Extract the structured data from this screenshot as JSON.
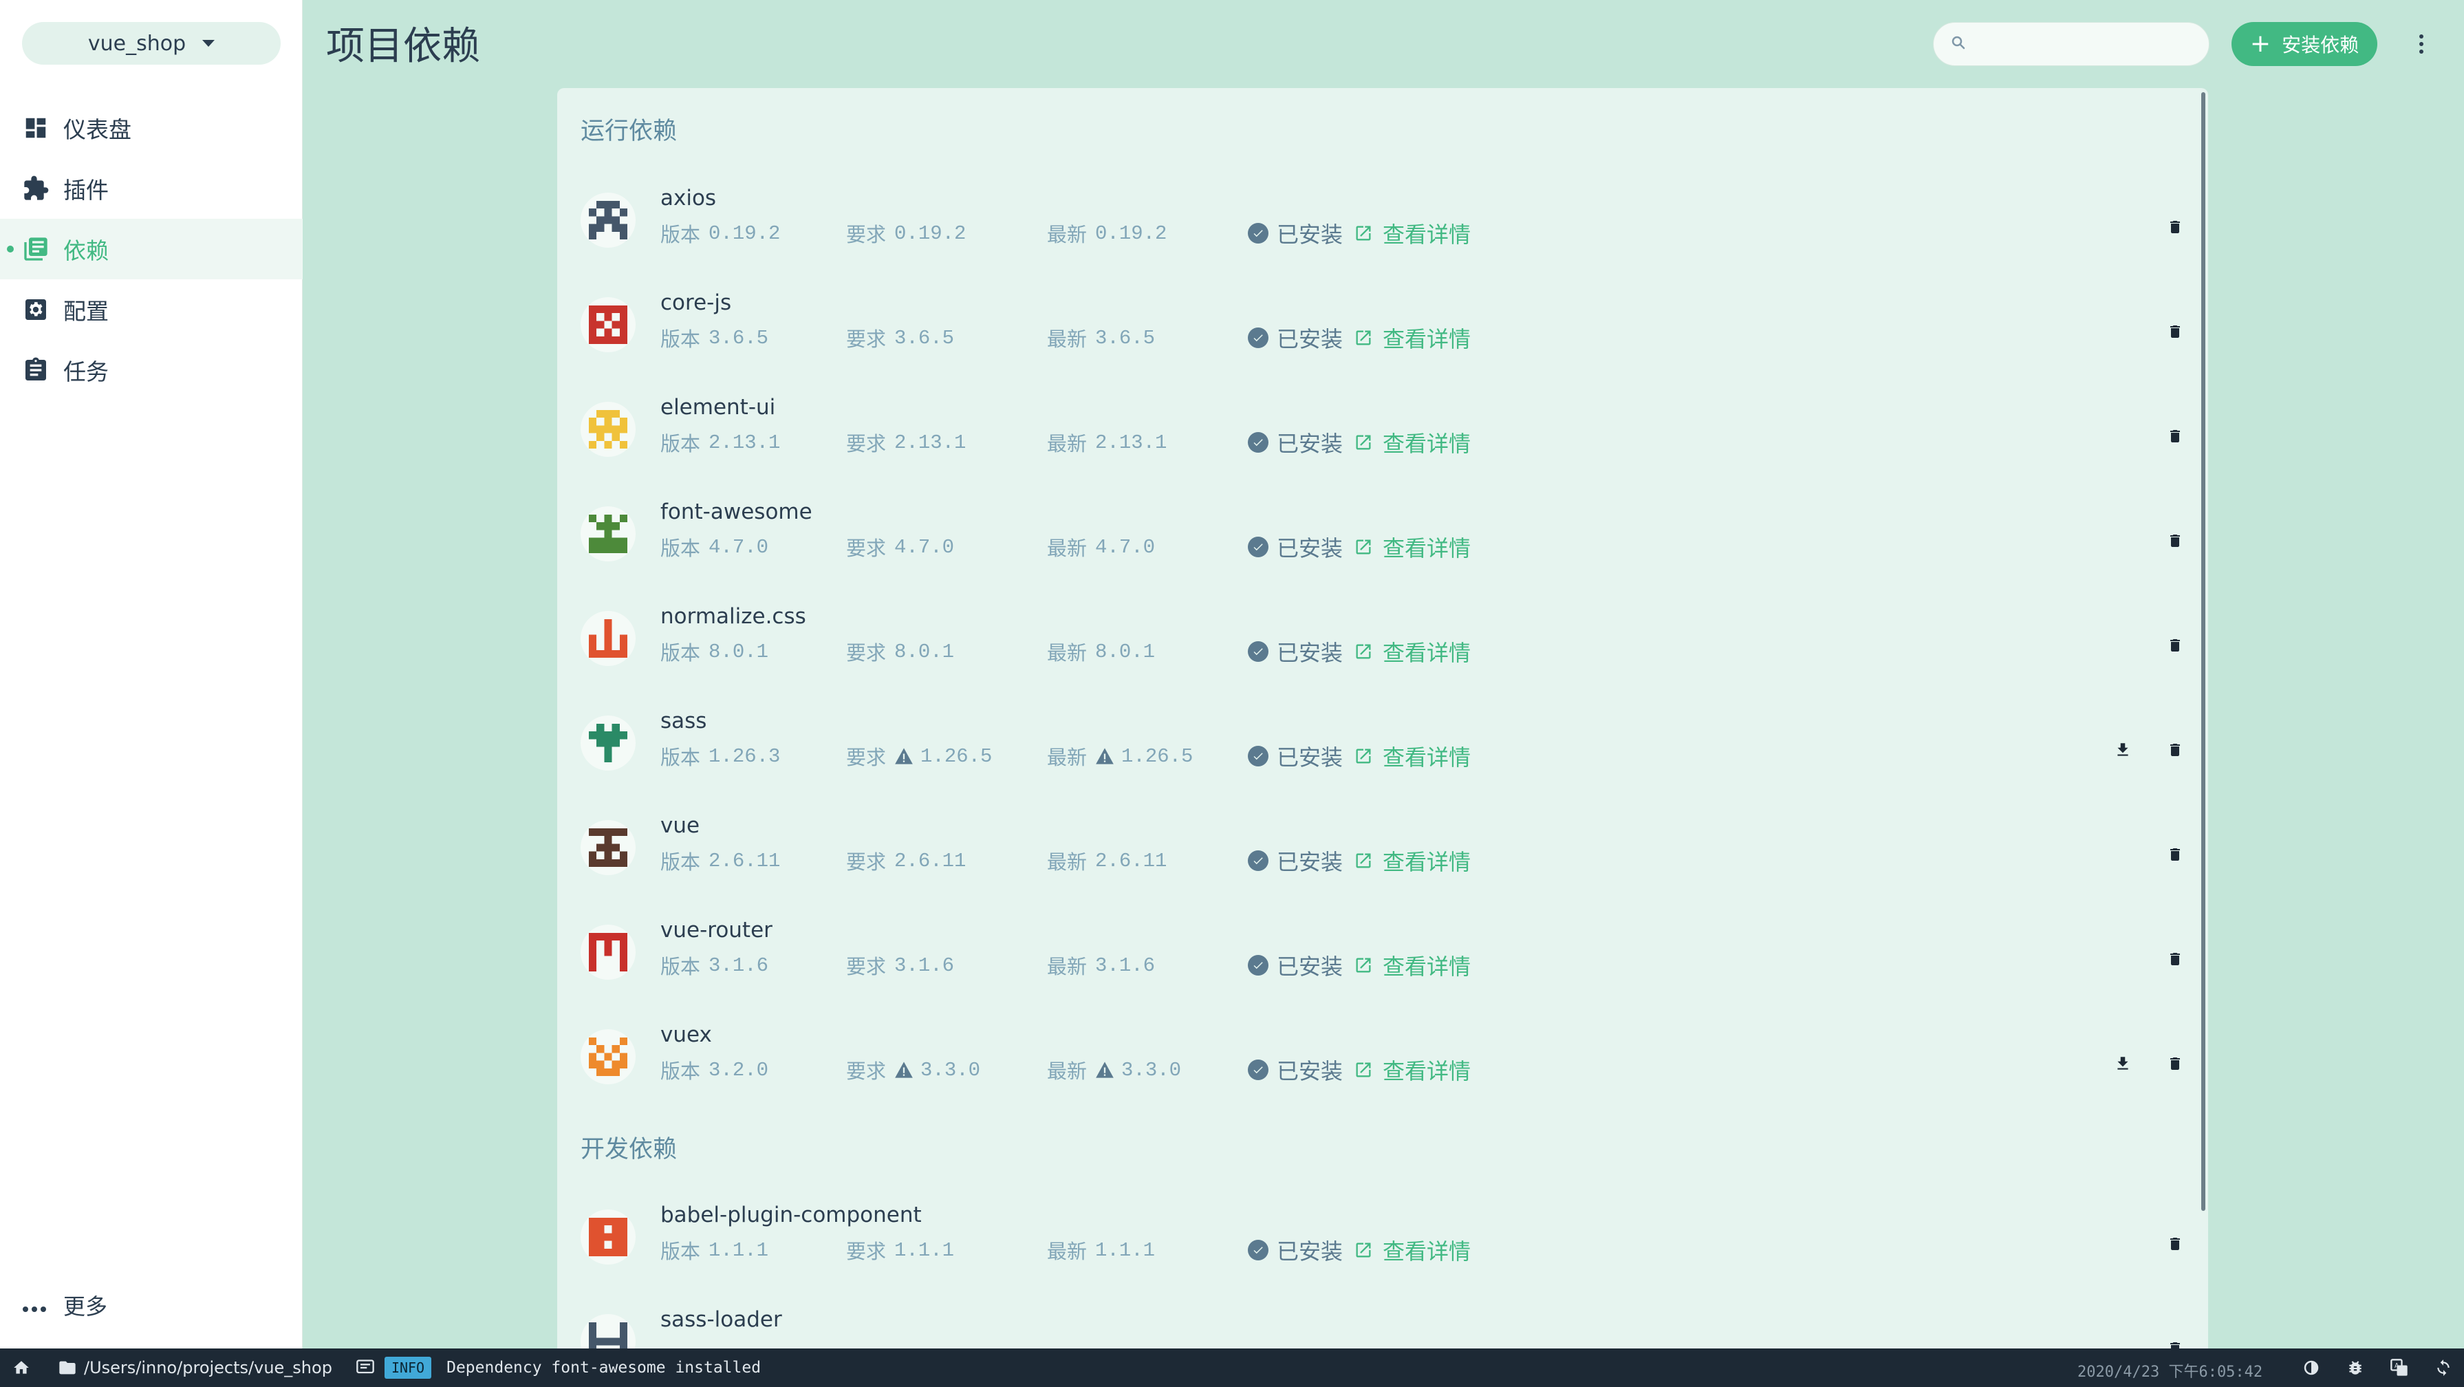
{
  "sidebar": {
    "project": "vue_shop",
    "items": [
      {
        "label": "仪表盘",
        "icon": "dashboard-icon"
      },
      {
        "label": "插件",
        "icon": "puzzle-icon"
      },
      {
        "label": "依赖",
        "icon": "library-icon",
        "active": true
      },
      {
        "label": "配置",
        "icon": "settings-icon"
      },
      {
        "label": "任务",
        "icon": "clipboard-icon"
      }
    ],
    "more_label": "更多"
  },
  "header": {
    "title": "项目依赖",
    "search_placeholder": "",
    "install_label": "安装依赖"
  },
  "labels": {
    "version": "版本",
    "wanted": "要求",
    "latest": "最新",
    "installed": "已安装",
    "details": "查看详情"
  },
  "sections": {
    "runtime_title": "运行依赖",
    "dev_title": "开发依赖"
  },
  "runtime_deps": [
    {
      "name": "axios",
      "version": "0.19.2",
      "wanted": "0.19.2",
      "latest": "0.19.2",
      "color": "#45576a",
      "update": false
    },
    {
      "name": "core-js",
      "version": "3.6.5",
      "wanted": "3.6.5",
      "latest": "3.6.5",
      "color": "#c8342d",
      "update": false
    },
    {
      "name": "element-ui",
      "version": "2.13.1",
      "wanted": "2.13.1",
      "latest": "2.13.1",
      "color": "#f0c23b",
      "update": false
    },
    {
      "name": "font-awesome",
      "version": "4.7.0",
      "wanted": "4.7.0",
      "latest": "4.7.0",
      "color": "#4d8a3a",
      "update": false
    },
    {
      "name": "normalize.css",
      "version": "8.0.1",
      "wanted": "8.0.1",
      "latest": "8.0.1",
      "color": "#e0522f",
      "update": false
    },
    {
      "name": "sass",
      "version": "1.26.3",
      "wanted": "1.26.5",
      "latest": "1.26.5",
      "color": "#2a8a66",
      "update": true
    },
    {
      "name": "vue",
      "version": "2.6.11",
      "wanted": "2.6.11",
      "latest": "2.6.11",
      "color": "#5a3a2e",
      "update": false
    },
    {
      "name": "vue-router",
      "version": "3.1.6",
      "wanted": "3.1.6",
      "latest": "3.1.6",
      "color": "#c8302b",
      "update": false
    },
    {
      "name": "vuex",
      "version": "3.2.0",
      "wanted": "3.3.0",
      "latest": "3.3.0",
      "color": "#ee8a2c",
      "update": true
    }
  ],
  "dev_deps": [
    {
      "name": "babel-plugin-component",
      "version": "1.1.1",
      "wanted": "1.1.1",
      "latest": "1.1.1",
      "color": "#e0522f",
      "update": false
    },
    {
      "name": "sass-loader",
      "version": "",
      "wanted": "",
      "latest": "",
      "color": "#45576a",
      "update": false
    }
  ],
  "statusbar": {
    "path": "/Users/inno/projects/vue_shop",
    "level": "INFO",
    "message": "Dependency font-awesome installed",
    "time": "2020/4/23 下午6:05:42"
  }
}
